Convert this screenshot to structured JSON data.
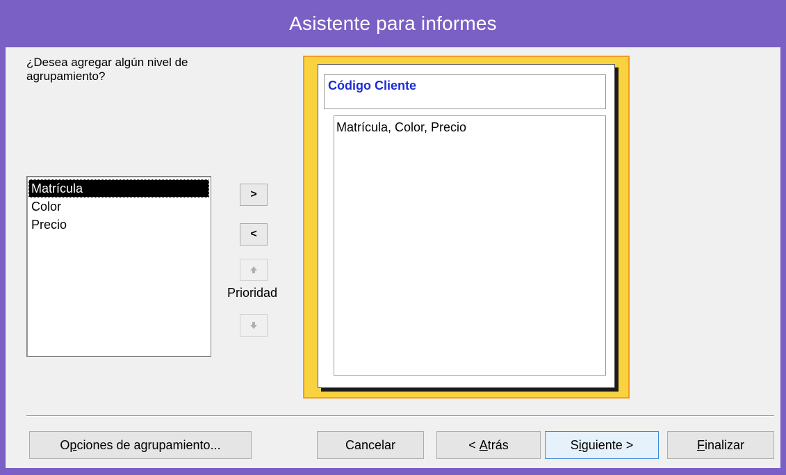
{
  "window": {
    "title": "Asistente para informes"
  },
  "prompt": "¿Desea agregar algún nivel de\nagrupamiento?",
  "fields": [
    {
      "label": "Matrícula",
      "selected": true
    },
    {
      "label": "Color",
      "selected": false
    },
    {
      "label": "Precio",
      "selected": false
    }
  ],
  "controls": {
    "add_label": ">",
    "remove_label": "<",
    "priority_up_icon": "up-arrow-icon",
    "priority_down_icon": "down-arrow-icon",
    "priority_label": "Prioridad"
  },
  "preview": {
    "group_header": "Código Cliente",
    "detail_fields": "Matrícula, Color, Precio"
  },
  "buttons": {
    "grouping_options": {
      "pre": "O",
      "accel": "p",
      "post": "ciones de agrupamiento..."
    },
    "cancel": "Cancelar",
    "back": {
      "pre": "< ",
      "accel": "A",
      "post": "trás"
    },
    "next": {
      "pre": "S",
      "accel": "i",
      "post": "guiente >"
    },
    "finish": {
      "pre": "",
      "accel": "F",
      "post": "inalizar"
    }
  },
  "colors": {
    "title_bar": "#7a5fc4",
    "group_header_text": "#1c2dd6",
    "preview_frame": "#f9d240"
  }
}
